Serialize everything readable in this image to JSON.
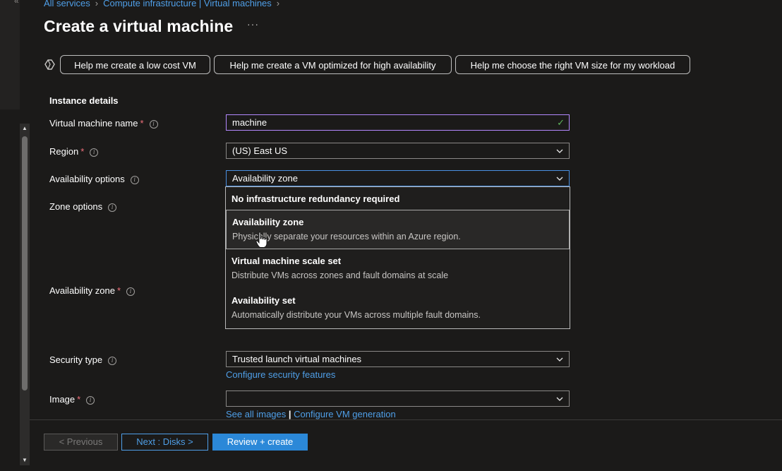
{
  "breadcrumb": {
    "items": [
      "All services",
      "Compute infrastructure | Virtual machines"
    ]
  },
  "page": {
    "title": "Create a virtual machine",
    "more": "···"
  },
  "copilot": {
    "buttons": [
      "Help me create a low cost VM",
      "Help me create a VM optimized for high availability",
      "Help me choose the right VM size for my workload"
    ]
  },
  "instance": {
    "section_title": "Instance details",
    "vm_name": {
      "label": "Virtual machine name",
      "value": "machine",
      "required": "*"
    },
    "region": {
      "label": "Region",
      "value": "(US) East US",
      "required": "*"
    },
    "availability": {
      "label": "Availability options",
      "value": "Availability zone"
    },
    "zone_options": {
      "label": "Zone options"
    },
    "availability_zone": {
      "label": "Availability zone",
      "required": "*"
    },
    "security": {
      "label": "Security type",
      "value": "Trusted launch virtual machines",
      "link": "Configure security features"
    },
    "image": {
      "label": "Image",
      "value": "",
      "required": "*",
      "link_all": "See all images",
      "link_sep": "|",
      "link_gen": "Configure VM generation"
    }
  },
  "dropdown": {
    "options": [
      {
        "title": "No infrastructure redundancy required",
        "desc": ""
      },
      {
        "title": "Availability zone",
        "desc": "Physically separate your resources within an Azure region."
      },
      {
        "title": "Virtual machine scale set",
        "desc": "Distribute VMs across zones and fault domains at scale"
      },
      {
        "title": "Availability set",
        "desc": "Automatically distribute your VMs across multiple fault domains."
      }
    ],
    "selected_index": 1
  },
  "footer": {
    "previous": "< Previous",
    "next": "Next : Disks >",
    "review": "Review + create"
  },
  "colors": {
    "accent": "#2b88d8",
    "link": "#4f9fe8",
    "required": "#f1707b",
    "valid": "#5fb35c",
    "focus": "#b388ff"
  },
  "icons": [
    "collapse-icon",
    "chevron-right-icon",
    "more-icon",
    "copilot-icon",
    "info-icon",
    "checkmark-icon",
    "chevron-down-icon",
    "pointer-cursor-icon"
  ]
}
